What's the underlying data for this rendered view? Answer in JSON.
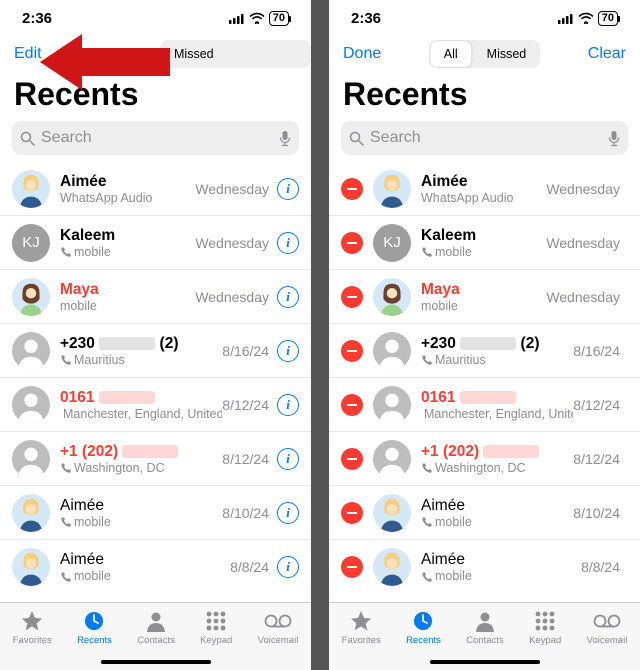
{
  "status": {
    "time": "2:36",
    "battery": "70"
  },
  "left": {
    "nav": {
      "edit": "Edit",
      "seg_missed": "Missed"
    },
    "title": "Recents",
    "search": "Search"
  },
  "right": {
    "nav": {
      "done": "Done",
      "seg_all": "All",
      "seg_missed": "Missed",
      "clear": "Clear"
    },
    "title": "Recents",
    "search": "Search"
  },
  "calls": [
    {
      "name": "Aimée",
      "sub": "WhatsApp Audio",
      "icon": "none",
      "date": "Wednesday",
      "avatar": "f1",
      "missed": false,
      "bold": true
    },
    {
      "name": "Kaleem",
      "sub": "mobile",
      "icon": "phone",
      "date": "Wednesday",
      "avatar": "kj",
      "missed": false,
      "bold": true
    },
    {
      "name": "Maya",
      "sub": "mobile",
      "icon": "none",
      "date": "Wednesday",
      "avatar": "f2",
      "missed": true,
      "bold": true
    },
    {
      "name": "+230",
      "redact": "gray",
      "suffix": " (2)",
      "sub": "Mauritius",
      "icon": "phone",
      "date": "8/16/24",
      "avatar": "gen",
      "missed": false,
      "bold": true
    },
    {
      "name": "0161",
      "redact": "red",
      "sub": "Manchester, England, United...",
      "icon": "phone",
      "date": "8/12/24",
      "avatar": "gen",
      "missed": true,
      "bold": true
    },
    {
      "name": "+1 (202)",
      "redact": "red",
      "sub": "Washington, DC",
      "icon": "phone",
      "date": "8/12/24",
      "avatar": "gen",
      "missed": true,
      "bold": true
    },
    {
      "name": "Aimée",
      "sub": "mobile",
      "icon": "phone",
      "date": "8/10/24",
      "avatar": "f3",
      "missed": false,
      "bold": false
    },
    {
      "name": "Aimée",
      "sub": "mobile",
      "icon": "phone",
      "date": "8/8/24",
      "avatar": "f3",
      "missed": false,
      "bold": false
    }
  ],
  "tabs": [
    {
      "label": "Favorites",
      "icon": "star"
    },
    {
      "label": "Recents",
      "icon": "clock"
    },
    {
      "label": "Contacts",
      "icon": "person"
    },
    {
      "label": "Keypad",
      "icon": "keypad"
    },
    {
      "label": "Voicemail",
      "icon": "vm"
    }
  ]
}
